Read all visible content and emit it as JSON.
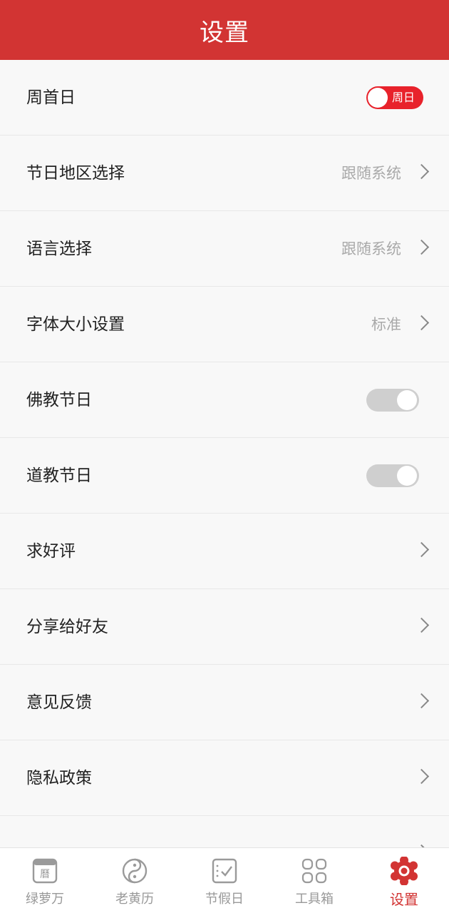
{
  "header": {
    "title": "设置"
  },
  "settings": {
    "week_start": {
      "label": "周首日",
      "toggle_text": "周日"
    },
    "holiday_region": {
      "label": "节日地区选择",
      "value": "跟随系统"
    },
    "language": {
      "label": "语言选择",
      "value": "跟随系统"
    },
    "font_size": {
      "label": "字体大小设置",
      "value": "标准"
    },
    "buddhist": {
      "label": "佛教节日"
    },
    "taoist": {
      "label": "道教节日"
    },
    "rate": {
      "label": "求好评"
    },
    "share": {
      "label": "分享给好友"
    },
    "feedback": {
      "label": "意见反馈"
    },
    "privacy": {
      "label": "隐私政策"
    }
  },
  "tabbar": {
    "tabs": [
      {
        "label": "绿萝万",
        "icon": "calendar-icon"
      },
      {
        "label": "老黄历",
        "icon": "yin-yang-icon"
      },
      {
        "label": "节假日",
        "icon": "checklist-icon"
      },
      {
        "label": "工具箱",
        "icon": "grid-icon"
      },
      {
        "label": "设置",
        "icon": "settings-icon"
      }
    ],
    "active_index": 4
  },
  "colors": {
    "accent": "#d23433",
    "toggle_on": "#e8222b",
    "toggle_off": "#cfcfcf"
  }
}
